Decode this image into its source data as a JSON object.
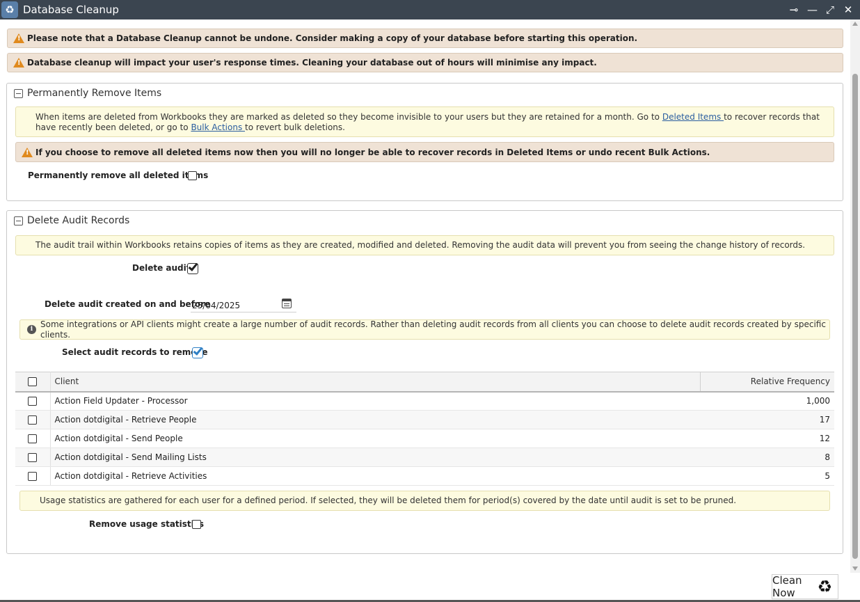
{
  "window": {
    "title": "Database Cleanup",
    "app_icon": "recycle-icon",
    "controls": [
      "pin-icon",
      "minimize-icon",
      "maximize-icon",
      "close-icon"
    ]
  },
  "warnings": [
    "Please note that a Database Cleanup cannot be undone. Consider making a copy of your database before starting this operation.",
    "Database cleanup will impact your user's response times. Cleaning your database out of hours will minimise any impact."
  ],
  "remove_items": {
    "header": "Permanently Remove Items",
    "info_part1": "When items are deleted from Workbooks they are marked as deleted so they become invisible to your users but they are retained for a month. Go to ",
    "deleted_items_link": "Deleted Items ",
    "info_part2": "to recover records that have recently been deleted, or go to ",
    "bulk_actions_link": "Bulk Actions ",
    "info_part3": "to revert bulk deletions.",
    "warning": "If you choose to remove all deleted items now then you will no longer be able to recover records in Deleted Items or undo recent Bulk Actions.",
    "checkbox_label": "Permanently remove all deleted items",
    "checked": false
  },
  "audit": {
    "header": "Delete Audit Records",
    "info": "The audit trail within Workbooks retains copies of items as they are created, modified and deleted. Removing the audit data will prevent you from seeing the change history of records.",
    "delete_audit_label": "Delete audit",
    "delete_audit_checked": true,
    "date_label": "Delete audit created on and before",
    "date_value": "25/04/2025",
    "clients_info": "Some integrations or API clients might create a large number of audit records. Rather than deleting audit records from all clients you can choose to delete audit records created by specific clients.",
    "select_label": "Select audit records to remove",
    "select_checked": true,
    "table": {
      "columns": [
        "Client",
        "Relative Frequency"
      ],
      "rows": [
        {
          "client": "Action Field Updater - Processor",
          "freq": "1,000"
        },
        {
          "client": "Action dotdigital - Retrieve People",
          "freq": "17"
        },
        {
          "client": "Action dotdigital - Send People",
          "freq": "12"
        },
        {
          "client": "Action dotdigital - Send Mailing Lists",
          "freq": "8"
        },
        {
          "client": "Action dotdigital - Retrieve Activities",
          "freq": "5"
        }
      ]
    },
    "usage_info": "Usage statistics are gathered for each user for a defined period. If selected, they will be deleted them for period(s) covered by the date until audit is set to be pruned.",
    "usage_label": "Remove usage statistics",
    "usage_checked": false
  },
  "footer": {
    "clean_now": "Clean Now"
  },
  "colors": {
    "titlebar": "#3b4550",
    "warning_bg": "#efe2d5",
    "info_bg": "#fdfbe0",
    "warning_icon": "#e08a1e",
    "checkbox_blue": "#2f7fc4"
  }
}
